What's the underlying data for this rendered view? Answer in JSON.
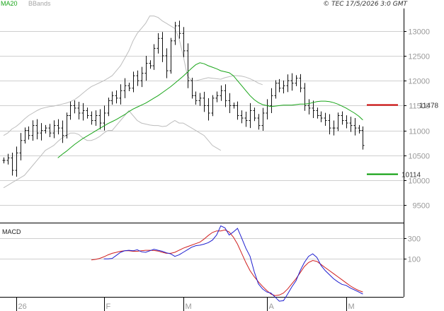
{
  "legend": {
    "ma": "MA20",
    "bb": "BBands"
  },
  "copyright": "© TEC 17/5/2026 3:0 GMT",
  "macd_label": "MACD",
  "colors": {
    "ma": "#19a519",
    "bb": "#bdbdbd",
    "macd": "#1f1fd0",
    "signal": "#d01f1f",
    "resistance": "#cc0000",
    "support": "#009900",
    "bar": "#111111",
    "grid": "#cfcfcf"
  },
  "chart_data": [
    {
      "type": "ohlc",
      "price_axis": {
        "ylim": [
          9150,
          13450
        ],
        "ticks": [
          9500,
          10000,
          10500,
          11000,
          11500,
          12000,
          12500,
          13000
        ]
      },
      "x_labels": [
        {
          "label": "26",
          "index": 3
        },
        {
          "label": "F",
          "index": 24
        },
        {
          "label": "M",
          "index": 43
        },
        {
          "label": "A",
          "index": 63
        },
        {
          "label": "M",
          "index": 82
        }
      ],
      "levels": [
        {
          "label": "11478",
          "value": 11525,
          "kind": "resistance"
        },
        {
          "label": "10114",
          "value": 10130,
          "kind": "support"
        }
      ],
      "close": [
        10400,
        10450,
        10200,
        10550,
        10800,
        11000,
        10900,
        11100,
        10950,
        11000,
        11050,
        10950,
        11100,
        11050,
        10900,
        11300,
        11500,
        11450,
        11350,
        11400,
        11300,
        11200,
        11300,
        11150,
        11350,
        11600,
        11700,
        11650,
        11800,
        11900,
        11850,
        12100,
        12000,
        12150,
        12350,
        12300,
        12650,
        12850,
        12500,
        12200,
        12800,
        13100,
        12950,
        12600,
        12000,
        11700,
        11600,
        11650,
        11500,
        11350,
        11650,
        11700,
        11800,
        11600,
        11500,
        11500,
        11300,
        11250,
        11200,
        11400,
        11250,
        11100,
        11350,
        11500,
        11700,
        11950,
        11850,
        11900,
        12000,
        11950,
        12050,
        11850,
        11500,
        11450,
        11400,
        11300,
        11250,
        11200,
        11050,
        11050,
        11300,
        11200,
        11150,
        11100,
        11050,
        11000,
        10700
      ],
      "ma20": [
        10450,
        10520,
        10580,
        10650,
        10720,
        10780,
        10840,
        10890,
        10940,
        10990,
        11040,
        11090,
        11140,
        11180,
        11220,
        11270,
        11320,
        11380,
        11430,
        11470,
        11510,
        11550,
        11600,
        11650,
        11700,
        11760,
        11820,
        11880,
        11950,
        12020,
        12090,
        12170,
        12250,
        12320,
        12360,
        12340,
        12300,
        12270,
        12240,
        12200,
        12180,
        12160,
        12100,
        12000,
        11900,
        11800,
        11700,
        11620,
        11560,
        11520,
        11500,
        11480,
        11490,
        11500,
        11510,
        11510,
        11510,
        11520,
        11530,
        11530,
        11540,
        11560,
        11580,
        11590,
        11590,
        11580,
        11560,
        11530,
        11490,
        11450,
        11400,
        11350,
        11290,
        11210
      ],
      "bb_upper": [
        10900,
        10950,
        11030,
        11080,
        11150,
        11230,
        11300,
        11350,
        11400,
        11440,
        11460,
        11480,
        11490,
        11510,
        11530,
        11550,
        11580,
        11620,
        11680,
        11750,
        11820,
        11880,
        11920,
        11960,
        12000,
        12050,
        12100,
        12200,
        12300,
        12450,
        12600,
        12800,
        12950,
        13050,
        13150,
        13300,
        13300,
        13270,
        13200,
        13150,
        13100,
        13050,
        12850,
        12500,
        12100,
        12000,
        12000,
        12020,
        12040,
        12060,
        12050,
        12040,
        12030,
        12060,
        12080,
        12100,
        12100,
        12090,
        12070,
        12040,
        12000,
        11950,
        11920
      ],
      "bb_lower": [
        9850,
        9900,
        9950,
        10000,
        10050,
        10100,
        10200,
        10300,
        10400,
        10500,
        10600,
        10650,
        10700,
        10780,
        10850,
        10900,
        10950,
        10950,
        10920,
        10850,
        10800,
        10800,
        10830,
        10880,
        10950,
        11000,
        11000,
        11100,
        11200,
        11300,
        11400,
        11300,
        11200,
        11150,
        11130,
        11110,
        11100,
        11100,
        11080,
        11090,
        11150,
        11200,
        11150,
        11150,
        11100,
        11050,
        11000,
        10950,
        10900,
        10800,
        10700,
        10650,
        10600
      ],
      "macd": [
        95,
        95,
        100,
        130,
        160,
        175,
        180,
        175,
        185,
        165,
        160,
        175,
        190,
        180,
        170,
        155,
        145,
        120,
        135,
        160,
        185,
        210,
        225,
        230,
        240,
        255,
        280,
        330,
        420,
        400,
        330,
        360,
        395,
        300,
        200,
        120,
        -30,
        -150,
        -200,
        -230,
        -240,
        -280,
        -320,
        -315,
        -250,
        -180,
        -120,
        -20,
        60,
        120,
        145,
        110,
        30,
        -20,
        -60,
        -100,
        -130,
        -155,
        -165,
        -190,
        -210,
        -230,
        -250
      ],
      "signal": [
        85,
        90,
        100,
        115,
        135,
        150,
        160,
        170,
        175,
        175,
        170,
        170,
        175,
        180,
        180,
        178,
        172,
        160,
        150,
        150,
        160,
        180,
        200,
        215,
        230,
        245,
        260,
        290,
        325,
        355,
        370,
        370,
        380,
        360,
        310,
        240,
        150,
        60,
        -20,
        -80,
        -130,
        -175,
        -215,
        -250,
        -265,
        -260,
        -240,
        -200,
        -150,
        -100,
        -40,
        20,
        60,
        80,
        70,
        40,
        10,
        -20,
        -50,
        -80,
        -110,
        -140,
        -170,
        -195,
        -215,
        -230
      ]
    }
  ]
}
